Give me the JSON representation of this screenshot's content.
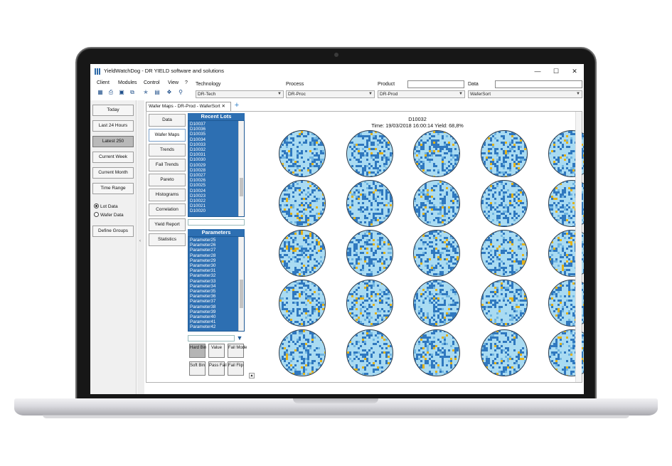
{
  "window": {
    "title": "YieldWatchDog - DR YIELD software and solutions",
    "minimize_glyph": "—",
    "maximize_glyph": "☐",
    "close_glyph": "✕"
  },
  "menu": [
    "Client",
    "Modules",
    "Control",
    "View",
    "?"
  ],
  "filters": [
    {
      "label": "Technology",
      "value": "DR-Tech"
    },
    {
      "label": "Process",
      "value": "DR-Proc"
    },
    {
      "label": "Product",
      "value": "DR-Prod"
    },
    {
      "label": "Data",
      "value": "WaferSort"
    }
  ],
  "left_panel": {
    "buttons": [
      "Today",
      "Last 24 Hours",
      "Latest 250",
      "Current Week",
      "Current Month",
      "Time Range"
    ],
    "radios": [
      "Lot Data",
      "Wafer Data"
    ],
    "define_groups": "Define Groups"
  },
  "tab": {
    "label": "Wafer Maps - DR-Prod - WaferSort"
  },
  "nav": [
    "Data",
    "Wafer Maps",
    "Trends",
    "Fail Trends",
    "Pareto",
    "Histograms",
    "Correlation",
    "Yield Report",
    "Statistics"
  ],
  "recent_lots": {
    "title": "Recent Lots",
    "items": [
      "D10037",
      "D10036",
      "D10035",
      "D10034",
      "D10033",
      "D10032",
      "D10031",
      "D10030",
      "D10029",
      "D10028",
      "D10027",
      "D10026",
      "D10025",
      "D10024",
      "D10023",
      "D10022",
      "D10021",
      "D10020"
    ]
  },
  "parameters": {
    "title": "Parameters",
    "items": [
      "Parameter25",
      "Parameter26",
      "Parameter27",
      "Parameter28",
      "Parameter29",
      "Parameter30",
      "Parameter31",
      "Parameter32",
      "Parameter33",
      "Parameter34",
      "Parameter35",
      "Parameter36",
      "Parameter37",
      "Parameter38",
      "Parameter39",
      "Parameter40",
      "Parameter41",
      "Parameter42"
    ]
  },
  "bin_buttons": [
    "Hard Bin",
    "Value",
    "Fail Mode",
    "Soft Bin",
    "Pass Fail",
    "Fail Flip"
  ],
  "wafer_view": {
    "lot": "D10032",
    "info": "Time: 19/03/2018 16:00:14 Yield: 68,8%"
  },
  "colors": {
    "wafer_fill": "#a9dbf2",
    "fail_blue": "#2f78bf",
    "fail_yellow": "#e3b21a",
    "wafer_rim": "#2b3a4a"
  }
}
